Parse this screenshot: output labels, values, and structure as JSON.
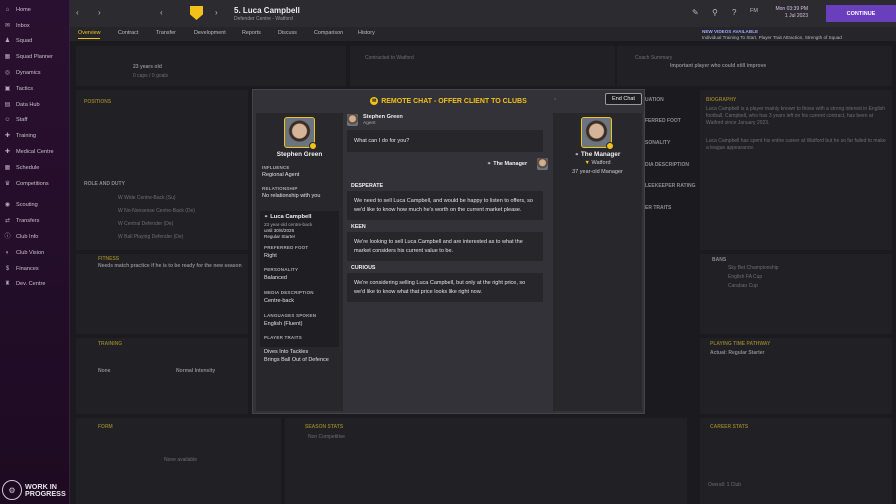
{
  "sidebar": {
    "items": [
      {
        "label": "Home",
        "icon": "home-icon",
        "glyph": "⌂"
      },
      {
        "label": "Inbox",
        "icon": "inbox-icon",
        "glyph": "✉"
      },
      {
        "label": "Squad",
        "icon": "squad-icon",
        "glyph": "♟"
      },
      {
        "label": "Squad Planner",
        "icon": "squad-planner-icon",
        "glyph": "▦"
      },
      {
        "label": "Dynamics",
        "icon": "dynamics-icon",
        "glyph": "◎"
      },
      {
        "label": "Tactics",
        "icon": "tactics-icon",
        "glyph": "▣"
      },
      {
        "label": "Data Hub",
        "icon": "data-hub-icon",
        "glyph": "▤"
      },
      {
        "label": "Staff",
        "icon": "staff-icon",
        "glyph": "☺"
      },
      {
        "label": "Training",
        "icon": "training-icon",
        "glyph": "✚"
      },
      {
        "label": "Medical Centre",
        "icon": "medical-icon",
        "glyph": "✚"
      },
      {
        "label": "Schedule",
        "icon": "schedule-icon",
        "glyph": "▦"
      },
      {
        "label": "Competitions",
        "icon": "competitions-icon",
        "glyph": "♛"
      },
      {
        "label": "Scouting",
        "icon": "scouting-icon",
        "glyph": "◉"
      },
      {
        "label": "Transfers",
        "icon": "transfers-icon",
        "glyph": "⇄"
      },
      {
        "label": "Club Info",
        "icon": "club-info-icon",
        "glyph": "ⓘ"
      },
      {
        "label": "Club Vision",
        "icon": "club-vision-icon",
        "glyph": "◐"
      },
      {
        "label": "Finances",
        "icon": "finances-icon",
        "glyph": "$"
      },
      {
        "label": "Dev. Centre",
        "icon": "dev-centre-icon",
        "glyph": "♜"
      }
    ],
    "wip_line1": "WORK IN",
    "wip_line2": "PROGRESS"
  },
  "topbar": {
    "player_title": "5. Luca Campbell",
    "player_sub": "Defender Centre - Watford",
    "lang": "FM",
    "date_line1": "Mon 03:39 PM",
    "date_line2": "1 Jul 2023",
    "continue": "CONTINUE"
  },
  "tabs": [
    "Overview",
    "Contract",
    "Transfer",
    "Development",
    "Reports",
    "Discuss",
    "Comparison",
    "History"
  ],
  "news": {
    "heading": "NEW VIDEOS AVAILABLE",
    "text": "Individual Training To Start, Player Trait Attraction, Strength of Squad"
  },
  "background": {
    "age": "23 years old",
    "caps": "0 caps / 0 goals",
    "positions": "POSITIONS",
    "role_duty": "ROLE AND DUTY",
    "contracted_to": "Contracted to Watford",
    "coach_summary": "Coach Summary",
    "important_player": "Important player who could still improve",
    "biography": "BIOGRAPHY",
    "bio_text1": "Luca Campbell is a player mainly known to those with a strong interest in English football. Campbell, who has 3 years left on his current contract, has been at Watford since January 2023.",
    "bio_text2": "Luca Campbell has spent his entire career at Watford but he so far failed to make a league appearance.",
    "fitness": "FITNESS",
    "fitness_text": "Needs match practice if he is to be ready for the new season",
    "training": "TRAINING",
    "none": "None",
    "normal_intensity": "Normal Intensity",
    "playing_time": "PLAYING TIME PATHWAY",
    "regular_starter": "Actual: Regular Starter",
    "form": "FORM",
    "none_available": "None available",
    "season_stats": "SEASON STATS",
    "non_competitive": "Non Competitive",
    "career_stats": "CAREER STATS",
    "overall": "Overall: 1 Club",
    "bans": "BANS",
    "bans_items": [
      "Sky Bet Championship",
      "English FA Cup",
      "Carabao Cup"
    ],
    "roles": [
      "W Wide Centre-Back (Su)",
      "W No-Nonsense Centre-Back (De)",
      "W Central Defender (De)",
      "W Ball Playing Defender (De)"
    ],
    "mid_labels": [
      "UATION",
      "FERRED FOOT",
      "SONALITY",
      "DIA DESCRIPTION",
      "LEEKEEPER RATING",
      "ER TRAITS"
    ]
  },
  "overlay": {
    "title": "REMOTE CHAT - OFFER CLIENT TO CLUBS",
    "end_chat": "End Chat",
    "left": {
      "name": "Stephen Green",
      "influence_label": "INFLUENCE",
      "influence": "Regional Agent",
      "relationship_label": "RELATIONSHIP",
      "relationship": "No relationship with you",
      "player_name": "Luca Campbell",
      "player_desc": "23 year-old centre-back",
      "player_until": "until 30/6/2026",
      "player_role": "Regular Starter",
      "pref_foot_label": "PREFERRED FOOT",
      "pref_foot": "Right",
      "personality_label": "PERSONALITY",
      "personality": "Balanced",
      "media_label": "MEDIA DESCRIPTION",
      "media": "Centre-back",
      "languages_label": "LANGUAGES SPOKEN",
      "languages": "English (Fluent)",
      "traits_label": "PLAYER TRAITS",
      "trait1": "Dives Into Tackles",
      "trait2": "Brings Ball Out of Defence"
    },
    "right": {
      "name": "The Manager",
      "club": "Watford",
      "desc": "37 year-old Manager"
    },
    "chat": {
      "agent_name": "Stephen Green",
      "agent_role": "Agent",
      "agent_question": "What can I do for you?",
      "manager_label": "The Manager",
      "options": [
        {
          "heading": "DESPERATE",
          "text": "We need to sell Luca Campbell, and would be happy to listen to offers, so we'd like to know how much he's worth on the current market please."
        },
        {
          "heading": "KEEN",
          "text": "We're looking to sell Luca Campbell and are interested as to what the market considers his current value to be."
        },
        {
          "heading": "CURIOUS",
          "text": "We're considering selling Luca Campbell, but only at the right price, so we'd like to know what that price looks like right now."
        }
      ]
    }
  },
  "colors": {
    "accent": "#f2c21b",
    "sidebar_bg": "#2a1030",
    "continue_bg": "#6a3fbd",
    "panel_bg": "#27272c"
  }
}
